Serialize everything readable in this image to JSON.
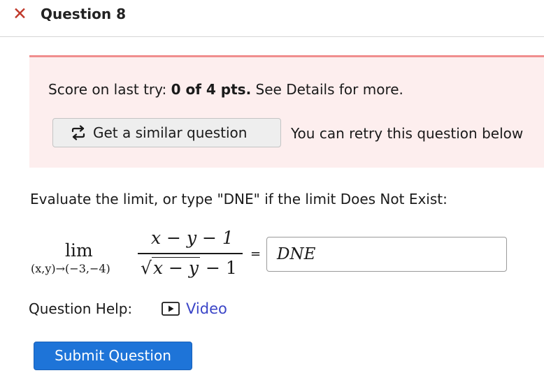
{
  "header": {
    "close_glyph": "✕",
    "title": "Question 8"
  },
  "score_notice": {
    "prefix": "Score on last try: ",
    "score": "0 of 4 pts.",
    "suffix": " See Details for more.",
    "similar_button_label": "Get a similar question",
    "retry_text": "You can retry this question below",
    "colors": {
      "background": "#fdeeee",
      "border": "#f08e8e"
    }
  },
  "question": {
    "prompt": "Evaluate the limit, or type \"DNE\" if the limit Does Not Exist:",
    "limit_word": "lim",
    "limit_subscript": "(x,y)→(−3,−4)",
    "numerator": "x − y − 1",
    "denominator_radicand": "x − y",
    "denominator_tail": " − 1",
    "equals": "=",
    "answer_value": "DNE"
  },
  "help": {
    "label": "Question Help:",
    "video_label": "Video",
    "icons": [
      "play-icon",
      "refresh-icon",
      "close-icon"
    ]
  },
  "submit": {
    "label": "Submit Question",
    "color": "#1e74d8"
  }
}
